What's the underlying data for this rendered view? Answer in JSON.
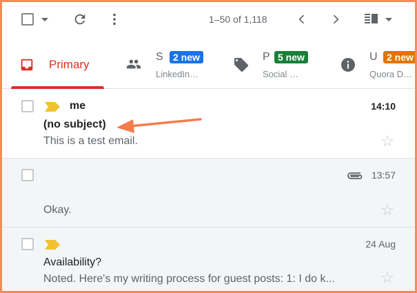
{
  "toolbar": {
    "pager": "1–50 of 1,118"
  },
  "tabs": [
    {
      "label": "Primary"
    },
    {
      "letter": "S",
      "badge": "2 new",
      "sub": "LinkedIn…"
    },
    {
      "letter": "P",
      "badge": "5 new",
      "sub": "Social …"
    },
    {
      "letter": "U",
      "badge": "2 new",
      "sub": "Quora D…"
    }
  ],
  "colors": {
    "primary_accent": "#d93025",
    "badge_social": "#1a73e8",
    "badge_promotions": "#188038",
    "badge_updates": "#e37400",
    "frame_border": "#f58a5a",
    "annotation_arrow": "#f37c4c",
    "important_marker": "#f2c12e"
  },
  "emails": [
    {
      "sender": "me",
      "subject": "(no subject)",
      "snippet": "This is a test email.",
      "time": "14:10",
      "unread": true,
      "important": true,
      "attachment": false
    },
    {
      "sender": "",
      "subject": "",
      "snippet": "Okay.",
      "time": "13:57",
      "unread": false,
      "important": false,
      "attachment": true
    },
    {
      "sender": "",
      "subject": "Availability?",
      "snippet": "Noted. Here's my writing process for guest posts: 1: I do k...",
      "time": "24 Aug",
      "unread": false,
      "important": true,
      "attachment": false
    }
  ]
}
